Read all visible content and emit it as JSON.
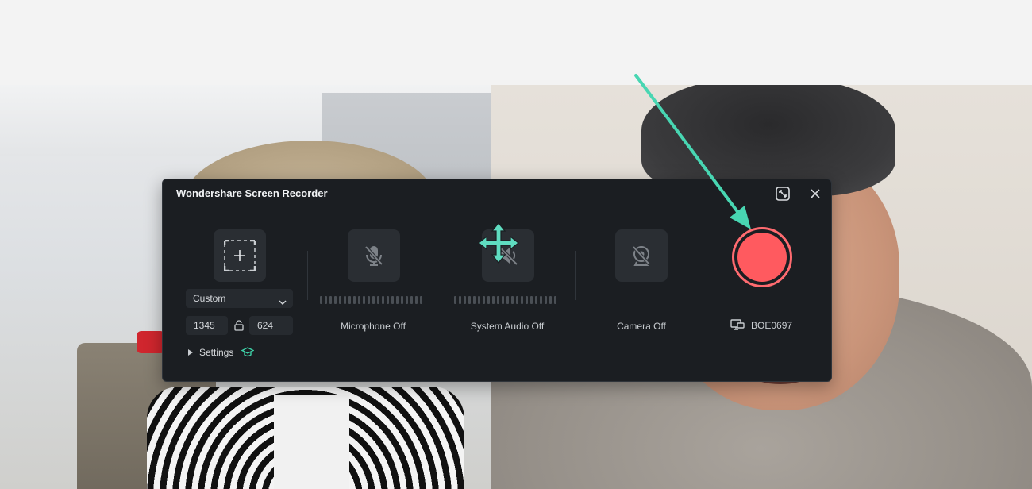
{
  "window": {
    "title": "Wondershare Screen Recorder"
  },
  "icons": {
    "minimize": "picture-in-picture-icon",
    "close": "close-icon",
    "region": "region-select-icon",
    "mic": "microphone-muted-icon",
    "system_audio": "speaker-muted-icon",
    "camera": "camera-off-icon",
    "move": "move-cursor-icon",
    "display": "display-monitor-icon",
    "settings_extra": "graduation-cap-icon"
  },
  "capture": {
    "mode_selected": "Custom",
    "width": "1345",
    "height": "624"
  },
  "sources": {
    "microphone_label": "Microphone Off",
    "system_audio_label": "System Audio Off",
    "camera_label": "Camera Off"
  },
  "display": {
    "name": "BOE0697"
  },
  "settings": {
    "label": "Settings"
  },
  "colors": {
    "panel_bg": "#1b1e22",
    "tile_bg": "#2a2e33",
    "record_red": "#ff5a5f",
    "annotation_teal": "#48d6b2"
  }
}
